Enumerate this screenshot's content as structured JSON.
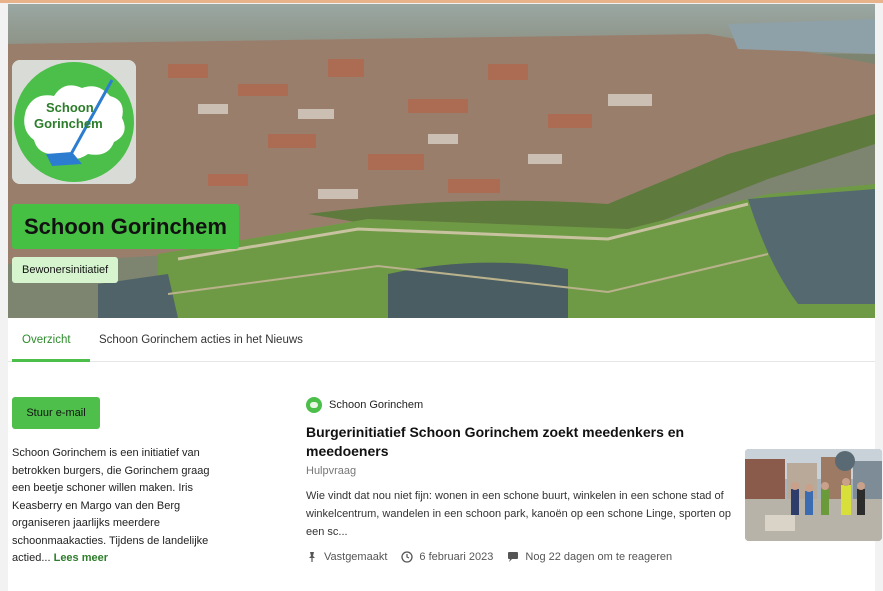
{
  "org": {
    "name": "Schoon Gorinchem",
    "type": "Bewonersinitiatief",
    "logo_text_line1": "Schoon",
    "logo_text_line2": "Gorinchem"
  },
  "tabs": [
    {
      "label": "Overzicht",
      "active": true
    },
    {
      "label": "Schoon Gorinchem acties in het Nieuws",
      "active": false
    }
  ],
  "sidebar": {
    "email_button": "Stuur e-mail",
    "about": "Schoon Gorinchem is een initiatief van betrokken burgers, die Gorinchem graag een beetje schoner willen maken. Iris Keasberry en Margo van den Berg organiseren jaarlijks meerdere schoonmaakacties. Tijdens de landelijke actied...",
    "read_more": "Lees meer"
  },
  "post": {
    "author": "Schoon Gorinchem",
    "title": "Burgerinitiatief Schoon Gorinchem zoekt meedenkers en meedoeners",
    "category": "Hulpvraag",
    "excerpt": "Wie vindt dat nou niet fijn: wonen in een schone buurt, winkelen in een schone stad of winkelcentrum, wandelen in een schoon park, kanoën op een schone Linge, sporten op een sc...",
    "pinned": "Vastgemaakt",
    "date": "6 februari 2023",
    "reply_deadline": "Nog 22 dagen om te reageren"
  },
  "icons": {
    "pin": "pin-icon",
    "clock": "clock-icon",
    "comment": "comment-icon",
    "org_avatar": "org-avatar-icon"
  },
  "colors": {
    "brand_green": "#46c043",
    "light_green": "#d6f5cf",
    "link_green": "#2d7d2b"
  }
}
